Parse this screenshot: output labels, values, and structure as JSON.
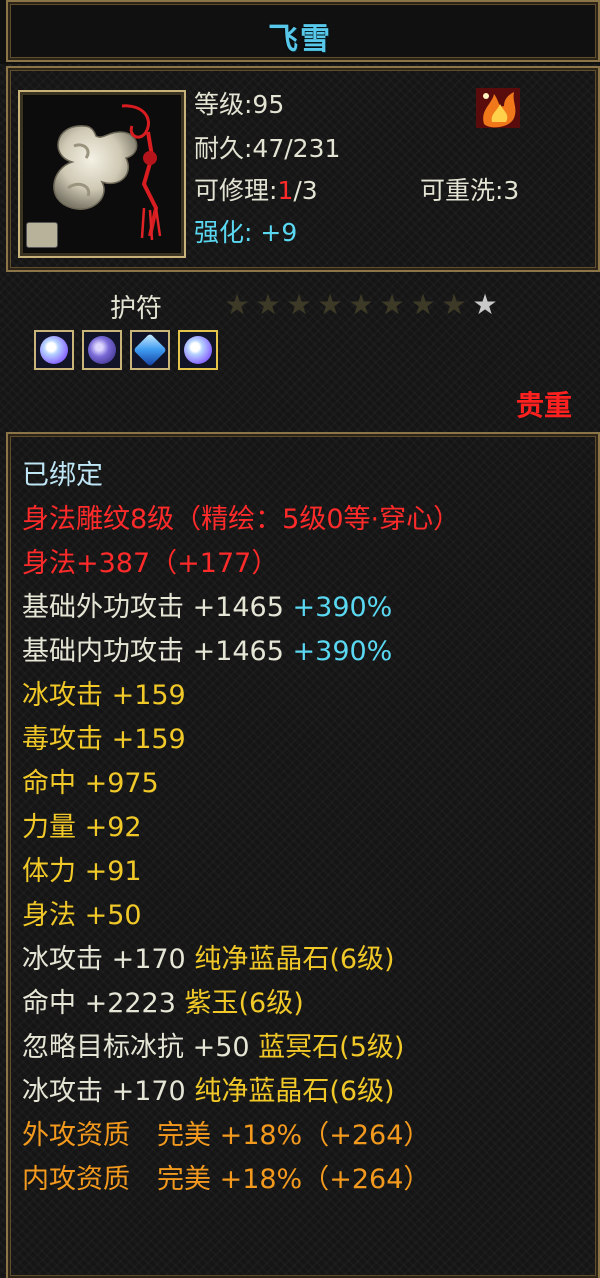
{
  "title": "飞雪",
  "header": {
    "level": "等级:95",
    "durability": "耐久:47/231",
    "repair_prefix": "可修理:",
    "repair_current": "1",
    "repair_suffix": "/3",
    "rewash": "可重洗:3",
    "enhance_label": "强化:",
    "enhance_value": "+9"
  },
  "gem_section": {
    "label": "护符",
    "stars_filled": 8,
    "stars_total": 9,
    "gems": [
      "blue-crystal",
      "purple-jade",
      "blue-sapphire",
      "blue-crystal"
    ],
    "quality": "贵重"
  },
  "attributes": {
    "bound": "已绑定",
    "engrave": "身法雕纹8级（精绘：5级0等·穿心）",
    "agility_main": "身法+387（+177）",
    "outer_attack_label": "基础外功攻击 +1465",
    "outer_attack_pct": "+390%",
    "inner_attack_label": "基础内功攻击 +1465",
    "inner_attack_pct": "+390%",
    "ice_attack": "冰攻击 +159",
    "poison_attack": "毒攻击 +159",
    "hit": "命中 +975",
    "strength": "力量 +92",
    "stamina": "体力 +91",
    "agility": "身法 +50",
    "gem1_stat": "冰攻击 +170",
    "gem1_name": "纯净蓝晶石(6级)",
    "gem2_stat": "命中 +2223",
    "gem2_name": "紫玉(6级)",
    "gem3_stat": "忽略目标冰抗 +50",
    "gem3_name": "蓝冥石(5级)",
    "gem4_stat": "冰攻击 +170",
    "gem4_name": "纯净蓝晶石(6级)",
    "outer_aptitude": "外攻资质　完美 +18%（+264）",
    "inner_aptitude": "内攻资质　完美 +18%（+264）"
  },
  "colors": {
    "title": "#58c8ea",
    "white": "#e6e6d6",
    "cyan": "#5ad8f2",
    "red": "#ff2a2a",
    "yellow": "#f0c828",
    "orange": "#f39a1e",
    "frame": "#8a7448"
  }
}
